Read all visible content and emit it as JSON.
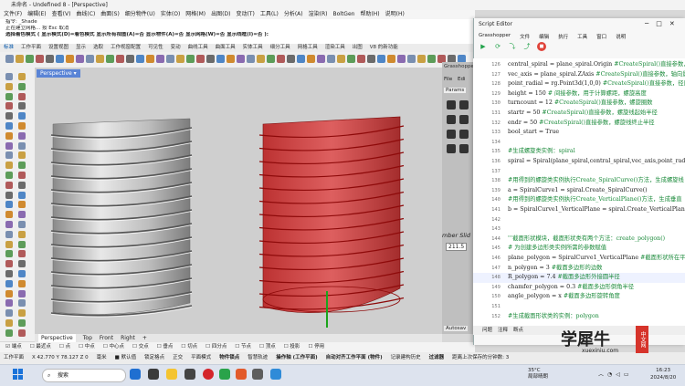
{
  "window": {
    "title": "未命名 - Undefined 8 - [Perspective]"
  },
  "menu": [
    "文件(F)",
    "编辑(E)",
    "查看(V)",
    "曲线(C)",
    "曲面(S)",
    "细分物件(U)",
    "实体(O)",
    "网格(M)",
    "出图(D)",
    "变动(T)",
    "工具(L)",
    "分析(A)",
    "渲染(R)",
    "BoltGen",
    "帮助(H)",
    "说明(H)"
  ],
  "command": {
    "line1": "指令: _Shade",
    "line2": "正在建立网格... 按 Esc 取消",
    "line3": "选择着色模式 ( 显示模式(D)=着色模式  显示所有视图(A)=否  显示物件(A)=否  显示网格(W)=否  显示线框(I)=否 ):"
  },
  "toolbar_tabs": [
    "标准",
    "工作平面",
    "设置视图",
    "显示",
    "选取",
    "工作视窗配置",
    "可见性",
    "变动",
    "曲线工具",
    "曲面工具",
    "实体工具",
    "细分工具",
    "网格工具",
    "渲染工具",
    "出图",
    "V8 的新功能"
  ],
  "viewport": {
    "label": "Perspective"
  },
  "view_tabs": [
    "Perspective",
    "Top",
    "Front",
    "Right",
    "+"
  ],
  "osnap": [
    "端点",
    "最近点",
    "点",
    "中点",
    "中心点",
    "交点",
    "垂点",
    "切点",
    "四分点",
    "节点",
    "顶点",
    "投影",
    "停用"
  ],
  "status": {
    "plane": "工作平面",
    "coords": "X 42.770 Y 78.127 Z 0",
    "unit": "毫米",
    "layer": "默认值",
    "items": [
      "锁定格点",
      "正交",
      "平面模式",
      "物件锁点",
      "智慧轨迹",
      "操作轴 (工作平面)",
      "自动对齐工作平面 (物件)",
      "记录建构历史",
      "过滤器",
      "距离上次保存的分钟数: 3"
    ]
  },
  "grasshopper": {
    "title": "Grasshopper",
    "menu": [
      "File",
      "Edi"
    ],
    "tab": "Params",
    "slider_label": "mber Slid",
    "slider_value": "211.5",
    "autosave": "Autosav"
  },
  "script_editor": {
    "title": "Script Editor",
    "menu": [
      "Grasshopper",
      "文件",
      "编辑",
      "执行",
      "工具",
      "窗口",
      "说明"
    ],
    "footer": [
      "问题",
      "注释",
      "断点"
    ],
    "lines": [
      {
        "n": "126",
        "code": "central_spiral = plane_spiral.Origin   ",
        "comment": "#CreateSpiral()直接参数，中心"
      },
      {
        "n": "127",
        "code": "vec_axis = plane_spiral.ZAxis       ",
        "comment": "#CreateSpiral()直接参数，轴向量"
      },
      {
        "n": "128",
        "code": "point_radial = rg.Point3d(1,0,0)    ",
        "comment": "#CreateSpiral()直接参数，径向"
      },
      {
        "n": "129",
        "code": "height = 150                ",
        "comment": "# 间接参数，用于计算螺距，螺旋高度"
      },
      {
        "n": "130",
        "code": "turncount = 12               ",
        "comment": "#CreateSpiral()直接参数，螺旋圈数"
      },
      {
        "n": "131",
        "code": "startr = 50                 ",
        "comment": "#CreateSpiral()直接参数，螺旋线起始半径"
      },
      {
        "n": "132",
        "code": "endr = 50                  ",
        "comment": "#CreateSpiral()直接参数，螺旋线终止半径"
      },
      {
        "n": "133",
        "code": "bool_start = True",
        "comment": ""
      },
      {
        "n": "134",
        "code": "",
        "comment": ""
      },
      {
        "n": "135",
        "code": "",
        "comment": "#生成螺旋类实例：spiral"
      },
      {
        "n": "136",
        "code": "spiral = Spiral(plane_spiral,central_spiral,vec_axis,point_radial,h",
        "comment": ""
      },
      {
        "n": "137",
        "code": "",
        "comment": ""
      },
      {
        "n": "138",
        "code": "",
        "comment": "#用得到的螺旋类实例执行Create_SpiralCurve()方法，生成螺旋线"
      },
      {
        "n": "139",
        "code": "a = SpiralCurve1 = spiral.Create_SpiralCurve()",
        "comment": ""
      },
      {
        "n": "140",
        "code": "",
        "comment": "#用得到的螺旋类实例执行Create_VerticalPlane()方法，生成垂直"
      },
      {
        "n": "141",
        "code": "b = SpiralCurve1_VerticalPlane = spiral.Create_VerticalPlane(Spi",
        "comment": ""
      },
      {
        "n": "142",
        "code": "",
        "comment": ""
      },
      {
        "n": "143",
        "code": "",
        "comment": ""
      },
      {
        "n": "144",
        "code": "",
        "comment": "'''截面形状模块，截面形状类有两个方法：create_polygon()"
      },
      {
        "n": "145",
        "code": "",
        "comment": "# 为创建多边形类实例所需的参数赋值"
      },
      {
        "n": "146",
        "code": "plane_polygon = SpiralCurve1_VerticalPlane    ",
        "comment": "#截面形状所在平面"
      },
      {
        "n": "147",
        "code": "n_polygon = 3                ",
        "comment": "#截面多边形的边数"
      },
      {
        "n": "148",
        "code": "R_polygon = 7.4               ",
        "comment": "#截面多边形外接圆半径"
      },
      {
        "n": "149",
        "code": "chamfer_polygon = 0.3           ",
        "comment": "#截面多边形倒角半径"
      },
      {
        "n": "150",
        "code": "angle_polygon = x              ",
        "comment": "#截面多边形旋转角度"
      },
      {
        "n": "151",
        "code": "",
        "comment": ""
      },
      {
        "n": "152",
        "code": "",
        "comment": "#生成截面形状类的实例：polygon"
      }
    ]
  },
  "watermark": {
    "cn": "学犀牛",
    "url": "xuexiniu.com",
    "box": "中文网"
  },
  "taskbar": {
    "search_placeholder": "搜索",
    "weather_temp": "35°C",
    "weather_desc": "局部晴朗",
    "time": "16:23",
    "date": "2024/8/20"
  },
  "colors": {
    "accent": "#5a84d6",
    "run": "#22a24a",
    "stop": "#e0433a",
    "helix_red": "#d42020"
  }
}
